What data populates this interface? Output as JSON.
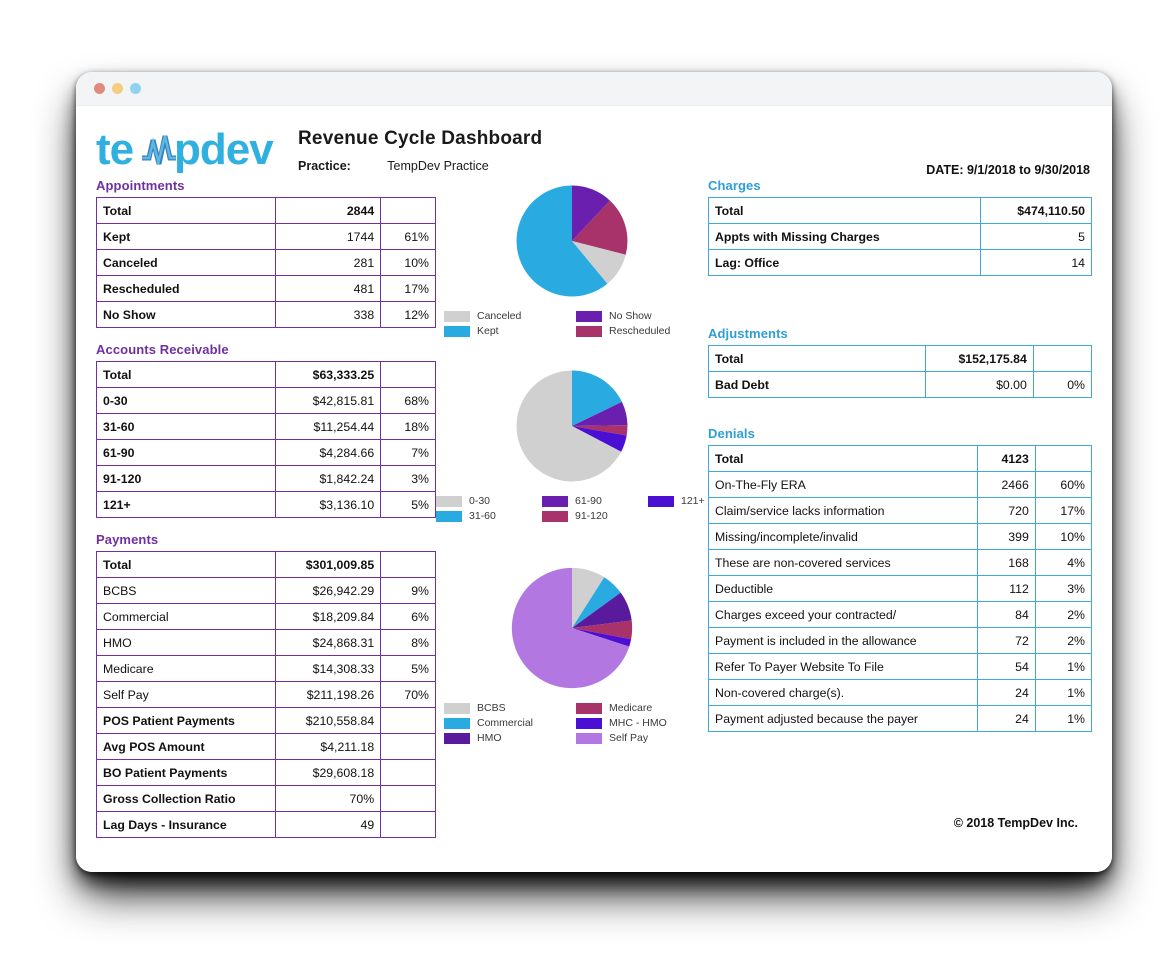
{
  "window": {
    "dots": [
      "close-dot",
      "minimize-dot",
      "maximize-dot"
    ]
  },
  "header": {
    "logo_text": "tempdev",
    "title": "Revenue Cycle Dashboard",
    "practice_label": "Practice:",
    "practice_value": "TempDev Practice",
    "date_range": "DATE: 9/1/2018 to 9/30/2018"
  },
  "footer": {
    "copyright": "© 2018 TempDev Inc."
  },
  "colors": {
    "purple": "#7030a0",
    "blue": "#3fa9dc",
    "gray": "#d0d0d0",
    "cyan": "#29abe2",
    "violet": "#4b0fd4",
    "magenta": "#a8326a",
    "deep_purple": "#6a1fae",
    "light_purple": "#b277e0"
  },
  "appointments": {
    "title": "Appointments",
    "rows": [
      {
        "label": "Total",
        "value": "2844",
        "pct": ""
      },
      {
        "label": "Kept",
        "value": "1744",
        "pct": "61%"
      },
      {
        "label": "Canceled",
        "value": "281",
        "pct": "10%"
      },
      {
        "label": "Rescheduled",
        "value": "481",
        "pct": "17%"
      },
      {
        "label": "No Show",
        "value": "338",
        "pct": "12%"
      }
    ]
  },
  "accounts_receivable": {
    "title": "Accounts Receivable",
    "rows": [
      {
        "label": "Total",
        "value": "$63,333.25",
        "pct": ""
      },
      {
        "label": "0-30",
        "value": "$42,815.81",
        "pct": "68%"
      },
      {
        "label": "31-60",
        "value": "$11,254.44",
        "pct": "18%"
      },
      {
        "label": "61-90",
        "value": "$4,284.66",
        "pct": "7%"
      },
      {
        "label": "91-120",
        "value": "$1,842.24",
        "pct": "3%"
      },
      {
        "label": "121+",
        "value": "$3,136.10",
        "pct": "5%"
      }
    ]
  },
  "payments": {
    "title": "Payments",
    "rows": [
      {
        "label": "Total",
        "value": "$301,009.85",
        "pct": "",
        "style": "total"
      },
      {
        "label": "BCBS",
        "value": "$26,942.29",
        "pct": "9%",
        "style": "indent"
      },
      {
        "label": "Commercial",
        "value": "$18,209.84",
        "pct": "6%",
        "style": "indent"
      },
      {
        "label": "HMO",
        "value": "$24,868.31",
        "pct": "8%",
        "style": "indent"
      },
      {
        "label": "Medicare",
        "value": "$14,308.33",
        "pct": "5%",
        "style": "indent"
      },
      {
        "label": "Self Pay",
        "value": "$211,198.26",
        "pct": "70%",
        "style": "indent"
      },
      {
        "label": "POS Patient Payments",
        "value": "$210,558.84",
        "pct": "",
        "style": "bold"
      },
      {
        "label": "Avg POS Amount",
        "value": "$4,211.18",
        "pct": "",
        "style": "bold"
      },
      {
        "label": "BO Patient Payments",
        "value": "$29,608.18",
        "pct": "",
        "style": "bold"
      },
      {
        "label": "Gross Collection Ratio",
        "value": "70%",
        "pct": "",
        "style": "bold"
      },
      {
        "label": "Lag Days - Insurance",
        "value": "49",
        "pct": "",
        "style": "bold"
      }
    ]
  },
  "charges": {
    "title": "Charges",
    "rows": [
      {
        "label": "Total",
        "value": "$474,110.50"
      },
      {
        "label": "Appts with Missing Charges",
        "value": "5"
      },
      {
        "label": "Lag: Office",
        "value": "14"
      }
    ]
  },
  "adjustments": {
    "title": "Adjustments",
    "rows": [
      {
        "label": "Total",
        "value": "$152,175.84",
        "pct": ""
      },
      {
        "label": "Bad Debt",
        "value": "$0.00",
        "pct": "0%"
      }
    ]
  },
  "denials": {
    "title": "Denials",
    "rows": [
      {
        "label": "Total",
        "value": "4123",
        "pct": "",
        "style": "total"
      },
      {
        "label": "On-The-Fly ERA",
        "value": "2466",
        "pct": "60%",
        "style": "normal"
      },
      {
        "label": "Claim/service lacks information",
        "value": "720",
        "pct": "17%",
        "style": "normal"
      },
      {
        "label": "Missing/incomplete/invalid",
        "value": "399",
        "pct": "10%",
        "style": "normal"
      },
      {
        "label": "These are non-covered services",
        "value": "168",
        "pct": "4%",
        "style": "normal"
      },
      {
        "label": "Deductible",
        "value": "112",
        "pct": "3%",
        "style": "normal"
      },
      {
        "label": "Charges exceed your contracted/",
        "value": "84",
        "pct": "2%",
        "style": "normal"
      },
      {
        "label": "Payment is included in the allowance",
        "value": "72",
        "pct": "2%",
        "style": "normal"
      },
      {
        "label": "Refer To Payer Website To File",
        "value": "54",
        "pct": "1%",
        "style": "normal"
      },
      {
        "label": "Non-covered charge(s).",
        "value": "24",
        "pct": "1%",
        "style": "normal"
      },
      {
        "label": "Payment adjusted because the payer",
        "value": "24",
        "pct": "1%",
        "style": "normal"
      }
    ]
  },
  "chart_data": [
    {
      "type": "pie",
      "name": "appointments-pie",
      "title": "",
      "legend_position": "bottom",
      "categories": [
        "Canceled",
        "Kept",
        "No Show",
        "Rescheduled"
      ],
      "values": [
        10,
        61,
        12,
        17
      ],
      "slice_order": [
        "No Show",
        "Rescheduled",
        "Canceled",
        "Kept"
      ],
      "slice_values": [
        12,
        17,
        10,
        61
      ],
      "slice_colors": [
        "#6a1fae",
        "#a8326a",
        "#d0d0d0",
        "#29abe2"
      ],
      "legend_colors": [
        "#d0d0d0",
        "#29abe2",
        "#6a1fae",
        "#a8326a"
      ],
      "unit": "%"
    },
    {
      "type": "pie",
      "name": "accounts-receivable-pie",
      "title": "",
      "legend_position": "bottom",
      "categories": [
        "0-30",
        "31-60",
        "61-90",
        "91-120",
        "121+"
      ],
      "values": [
        68,
        18,
        7,
        3,
        5
      ],
      "slice_order": [
        "31-60",
        "61-90",
        "91-120",
        "121+",
        "0-30"
      ],
      "slice_values": [
        18,
        7,
        3,
        5,
        68
      ],
      "slice_colors": [
        "#29abe2",
        "#6a1fae",
        "#a8326a",
        "#4b0fd4",
        "#d0d0d0"
      ],
      "legend_colors": [
        "#d0d0d0",
        "#29abe2",
        "#6a1fae",
        "#a8326a",
        "#4b0fd4"
      ],
      "unit": "%"
    },
    {
      "type": "pie",
      "name": "payments-pie",
      "title": "",
      "legend_position": "bottom",
      "categories": [
        "BCBS",
        "Commercial",
        "HMO",
        "Medicare",
        "MHC - HMO",
        "Self Pay"
      ],
      "values": [
        9,
        6,
        8,
        5,
        2,
        70
      ],
      "slice_order": [
        "BCBS",
        "Commercial",
        "HMO",
        "Medicare",
        "MHC - HMO",
        "Self Pay"
      ],
      "slice_values": [
        9,
        6,
        8,
        5,
        2,
        70
      ],
      "slice_colors": [
        "#d0d0d0",
        "#29abe2",
        "#5a1a9e",
        "#a8326a",
        "#4b0fd4",
        "#b277e0"
      ],
      "legend_colors": [
        "#d0d0d0",
        "#29abe2",
        "#5a1a9e",
        "#a8326a",
        "#4b0fd4",
        "#b277e0"
      ],
      "unit": "%"
    }
  ]
}
